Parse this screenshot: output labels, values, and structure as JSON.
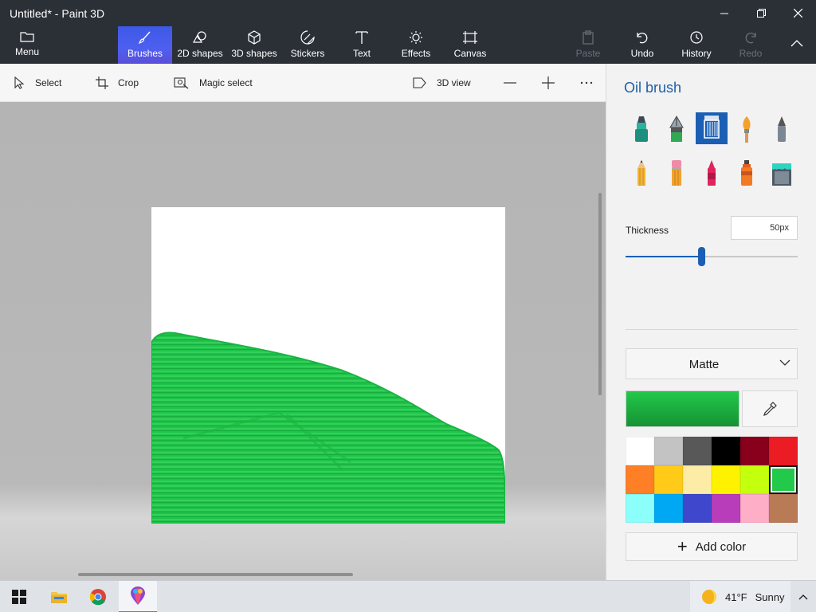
{
  "window": {
    "title": "Untitled* - Paint 3D"
  },
  "ribbon": {
    "menu": "Menu",
    "tabs": [
      "Brushes",
      "2D shapes",
      "3D shapes",
      "Stickers",
      "Text",
      "Effects",
      "Canvas"
    ],
    "active_tab": "Brushes",
    "actions": {
      "paste": "Paste",
      "undo": "Undo",
      "history": "History",
      "redo": "Redo"
    }
  },
  "toolbar": {
    "select": "Select",
    "crop": "Crop",
    "magic_select": "Magic select",
    "view_3d": "3D view"
  },
  "panel": {
    "title": "Oil brush",
    "brushes": [
      "marker",
      "calligraphy-pen",
      "oil-brush",
      "watercolor",
      "pixel-pen",
      "pencil",
      "eraser",
      "crayon",
      "spray-can",
      "fill"
    ],
    "selected_brush": "oil-brush",
    "thickness_label": "Thickness",
    "thickness_value": "50px",
    "thickness_fraction": 0.44,
    "finish": "Matte",
    "current_color": "#22c94a",
    "palette": [
      "#ffffff",
      "#c3c3c3",
      "#585858",
      "#000000",
      "#88001b",
      "#ec1c24",
      "#ff7f27",
      "#ffca18",
      "#fdeca6",
      "#fff200",
      "#c4ff0e",
      "#22c94a",
      "#8cfffb",
      "#00a8f3",
      "#3f48cc",
      "#b83dba",
      "#ffaec8",
      "#b97a56"
    ],
    "selected_swatch": 11,
    "add_color": "Add color"
  },
  "taskbar": {
    "apps": [
      "windows-start",
      "file-explorer",
      "chrome",
      "paint-3d"
    ],
    "weather": {
      "temp": "41°F",
      "condition": "Sunny"
    }
  }
}
